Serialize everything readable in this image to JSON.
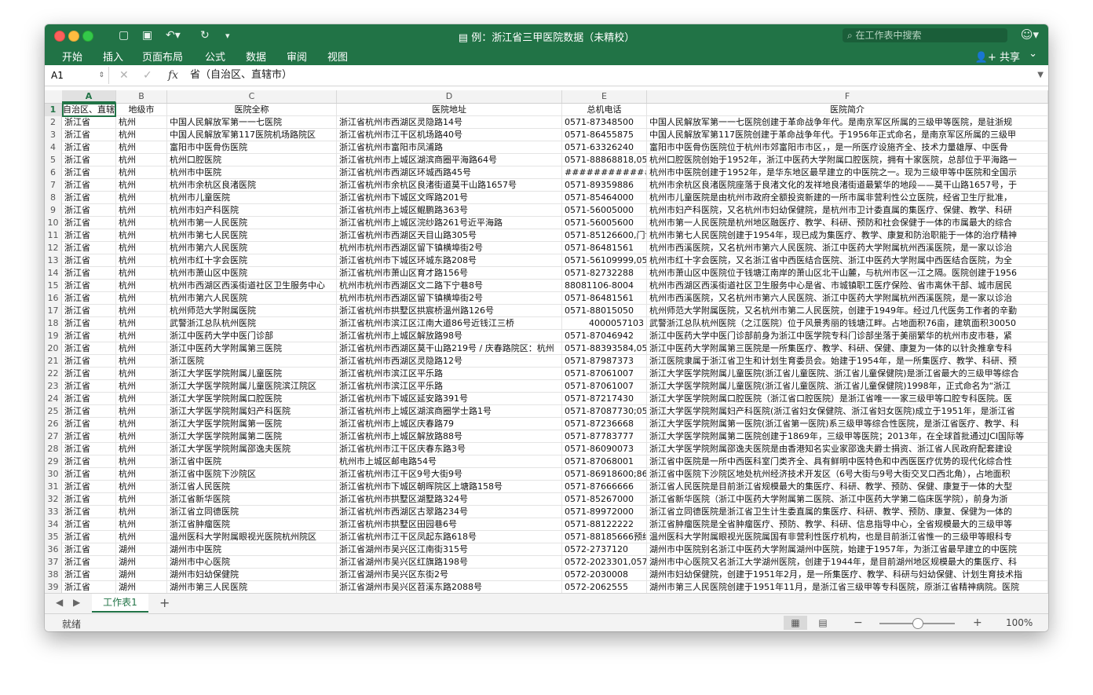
{
  "window": {
    "title": "例：浙江省三甲医院数据（未精校）",
    "search_placeholder": "在工作表中搜索"
  },
  "ribbon": {
    "tabs": [
      "开始",
      "插入",
      "页面布局",
      "公式",
      "数据",
      "审阅",
      "视图"
    ],
    "share_label": "共享"
  },
  "formula_bar": {
    "name_box": "A1",
    "fx": "fx",
    "formula": "省（自治区、直辖市）"
  },
  "grid": {
    "columns": [
      "A",
      "B",
      "C",
      "D",
      "E",
      "F"
    ],
    "header": [
      "自治区、直辖",
      "地级市",
      "医院全称",
      "医院地址",
      "总机电话",
      "医院简介"
    ],
    "rows": [
      [
        "浙江省",
        "杭州",
        "中国人民解放军第一一七医院",
        "浙江省杭州市西湖区灵隐路14号",
        "0571-87348500",
        "中国人民解放军第一一七医院创建于革命战争年代。是南京军区所属的三级甲等医院，是驻浙规"
      ],
      [
        "浙江省",
        "杭州",
        "中国人民解放军第117医院机场路院区",
        "浙江省杭州市江干区机场路40号",
        "0571-86455875",
        "中国人民解放军第117医院创建于革命战争年代。于1956年正式命名，是南京军区所属的三级甲"
      ],
      [
        "浙江省",
        "杭州",
        "富阳市中医骨伤医院",
        "浙江省杭州市富阳市凤浦路",
        "0571-63326240",
        "富阳市中医骨伤医院位于杭州市郊富阳市市区，，是一所医疗设施齐全、技术力量雄厚、中医骨"
      ],
      [
        "浙江省",
        "杭州",
        "杭州口腔医院",
        "浙江省杭州市上城区湖滨商圈平海路64号",
        "0571-88868818,057",
        "杭州口腔医院创始于1952年，浙江中医药大学附属口腔医院，拥有十家医院，总部位于平海路一"
      ],
      [
        "浙江省",
        "杭州",
        "杭州市中医院",
        "浙江省杭州市西湖区环城西路45号",
        "##############",
        "杭州市中医院创建于1952年，是华东地区最早建立的中医院之一。现为三级甲等中医院和全国示"
      ],
      [
        "浙江省",
        "杭州",
        "杭州市余杭区良渚医院",
        "浙江省杭州市余杭区良渚街道莫干山路1657号",
        "0571-89359886",
        "杭州市余杭区良渚医院座落于良渚文化的发祥地良渚街道最繁华的地段——莫干山路1657号，于"
      ],
      [
        "浙江省",
        "杭州",
        "杭州市儿童医院",
        "浙江省杭州市下城区文晖路201号",
        "0571-85464000",
        "杭州市儿童医院是由杭州市政府全额投资新建的一所市属非营利性公立医院，经省卫生厅批准，"
      ],
      [
        "浙江省",
        "杭州",
        "杭州市妇产科医院",
        "浙江省杭州市上城区鲲鹏路363号",
        "0571-56005000",
        "杭州市妇产科医院，又名杭州市妇幼保健院，是杭州市卫计委直属的集医疗、保健、教学、科研"
      ],
      [
        "浙江省",
        "杭州",
        "杭州市第一人民医院",
        "浙江省杭州市上城区浣纱路261号近平海路",
        "0571-56005600",
        "杭州市第一人民医院是杭州地区融医疗、教学、科研、预防和社会保健于一体的市属最大的综合"
      ],
      [
        "浙江省",
        "杭州",
        "杭州市第七人民医院",
        "浙江省杭州市西湖区天目山路305号",
        "0571-85126600,门诊",
        "杭州市第七人民医院创建于1954年，现已成为集医疗、教学、康复和防治职能于一体的治疗精神"
      ],
      [
        "浙江省",
        "杭州",
        "杭州市第六人民医院",
        "杭州市杭州市西湖区留下镇横埠街2号",
        "0571-86481561",
        "杭州市西溪医院，又名杭州市第六人民医院、浙江中医药大学附属杭州西溪医院，是一家以诊治"
      ],
      [
        "浙江省",
        "杭州",
        "杭州市红十字会医院",
        "浙江省杭州市下城区环城东路208号",
        "0571-56109999,057",
        "杭州市红十字会医院，又名浙江省中西医结合医院、浙江中医药大学附属中西医结合医院，为全"
      ],
      [
        "浙江省",
        "杭州",
        "杭州市萧山区中医院",
        "浙江省杭州市萧山区育才路156号",
        "0571-82732288",
        "杭州市萧山区中医院位于钱塘江南岸的萧山区北干山麓，与杭州市区一江之隔。医院创建于1956"
      ],
      [
        "浙江省",
        "杭州",
        "杭州市西湖区西溪街道社区卫生服务中心",
        "杭州市杭州市西湖区文二路下宁巷8号",
        "88081106-8004",
        "杭州市西湖区西溪街道社区卫生服务中心是省、市城镇职工医疗保险、省市离休干部、城市居民"
      ],
      [
        "浙江省",
        "杭州",
        "杭州市第六人民医院",
        "杭州市杭州市西湖区留下镇横埠街2号",
        "0571-86481561",
        "杭州市西溪医院，又名杭州市第六人民医院、浙江中医药大学附属杭州西溪医院，是一家以诊治"
      ],
      [
        "浙江省",
        "杭州",
        "杭州师范大学附属医院",
        "浙江省杭州市拱墅区拱宸桥温州路126号",
        "0571-88015050",
        "杭州师范大学附属医院，又名杭州市第二人民医院，创建于1949年。经过几代医务工作者的辛勤"
      ],
      [
        "浙江省",
        "杭州",
        "武警浙江总队杭州医院",
        "浙江省杭州市滨江区江南大道86号近钱江三桥",
        "4000057103",
        "武警浙江总队杭州医院（之江医院）位于风景秀丽的钱塘江畔。占地面积76亩，建筑面积30050"
      ],
      [
        "浙江省",
        "杭州",
        "浙江中医药大学中医门诊部",
        "浙江省杭州市上城区解放路98号",
        "0571-87046942",
        "浙江中医药大学中医门诊部前身为浙江中医学院专科门诊部坐落于美丽繁华的杭州市皮市巷，紧"
      ],
      [
        "浙江省",
        "杭州",
        "浙江中医药大学附属第三医院",
        "浙江省杭州市西湖区莫干山路219号 / 庆春路院区：杭州",
        "0571-88393584,057",
        "浙江中医药大学附属第三医院是一所集医疗、教学、科研、保健、康复为一体的以针灸推拿专科"
      ],
      [
        "浙江省",
        "杭州",
        "浙江医院",
        "浙江省杭州市西湖区灵隐路12号",
        "0571-87987373",
        "浙江医院隶属于浙江省卫生和计划生育委员会。始建于1954年，是一所集医疗、教学、科研、预"
      ],
      [
        "浙江省",
        "杭州",
        "浙江大学医学院附属儿童医院",
        "浙江省杭州市滨江区平乐路",
        "0571-87061007",
        "浙江大学医学院附属儿童医院(浙江省儿童医院、浙江省儿童保健院)是浙江省最大的三级甲等综合"
      ],
      [
        "浙江省",
        "杭州",
        "浙江大学医学院附属儿童医院滨江院区",
        "浙江省杭州市滨江区平乐路",
        "0571-87061007",
        "浙江大学医学院附属儿童医院(浙江省儿童医院、浙江省儿童保健院)1998年，正式命名为“浙江"
      ],
      [
        "浙江省",
        "杭州",
        "浙江大学医学院附属口腔医院",
        "浙江省杭州市下城区延安路391号",
        "0571-87217430",
        "浙江大学医学院附属口腔医院（浙江省口腔医院）是浙江省唯一一家三级甲等口腔专科医院。医"
      ],
      [
        "浙江省",
        "杭州",
        "浙江大学医学院附属妇产科医院",
        "浙江省杭州市上城区湖滨商圈学士路1号",
        "0571-87087730;057",
        "浙江大学医学院附属妇产科医院(浙江省妇女保健院、浙江省妇女医院)成立于1951年，是浙江省"
      ],
      [
        "浙江省",
        "杭州",
        "浙江大学医学院附属第一医院",
        "浙江省杭州市上城区庆春路79",
        "0571-87236668",
        "浙江大学医学院附属第一医院(浙江省第一医院)系三级甲等综合性医院，是浙江省医疗、教学、科"
      ],
      [
        "浙江省",
        "杭州",
        "浙江大学医学院附属第二医院",
        "浙江省杭州市上城区解放路88号",
        "0571-87783777",
        "浙江大学医学院附属第二医院创建于1869年，三级甲等医院；2013年，在全球首批通过JCI国际等"
      ],
      [
        "浙江省",
        "杭州",
        "浙江大学医学院附属邵逸夫医院",
        "浙江省杭州市江干区庆春东路3号",
        "0571-86090073",
        "浙江大学医学院附属邵逸夫医院是由香港知名实业家邵逸夫爵士捐资、浙江省人民政府配套建设"
      ],
      [
        "浙江省",
        "杭州",
        "浙江省中医院",
        "杭州市上城区邮电路54号",
        "0571-87068001",
        "浙江省中医院是一所中西医科室门类齐全、具有鲜明中医特色和中西医医疗优势的现代化综合性"
      ],
      [
        "浙江省",
        "杭州",
        "浙江省中医院下沙院区",
        "浙江省杭州市江干区9号大街9号",
        "0571-86918600;869",
        "浙江省中医院下沙院区地处杭州经济技术开发区（6号大街与9号大街交叉口西北角），占地面积"
      ],
      [
        "浙江省",
        "杭州",
        "浙江省人民医院",
        "浙江省杭州市下城区朝晖院区上塘路158号",
        "0571-87666666",
        "浙江省人民医院是目前浙江省规模最大的集医疗、科研、教学、预防、保健、康复于一体的大型"
      ],
      [
        "浙江省",
        "杭州",
        "浙江省新华医院",
        "浙江省杭州市拱墅区湖墅路324号",
        "0571-85267000",
        "浙江省新华医院（浙江中医药大学附属第二医院、浙江中医药大学第二临床医学院），前身为浙"
      ],
      [
        "浙江省",
        "杭州",
        "浙江省立同德医院",
        "浙江省杭州市西湖区古翠路234号",
        "0571-89972000",
        "浙江省立同德医院是浙江省卫生计生委直属的集医疗、科研、教学、预防、康复、保健为一体的"
      ],
      [
        "浙江省",
        "杭州",
        "浙江省肿瘤医院",
        "浙江省杭州市拱墅区田园巷6号",
        "0571-88122222",
        "浙江省肿瘤医院是全省肿瘤医疗、预防、教学、科研、信息指导中心，全省规模最大的三级甲等"
      ],
      [
        "浙江省",
        "杭州",
        "温州医科大学附属眼视光医院杭州院区",
        "浙江省杭州市江干区凤起东路618号",
        "0571-88185666预约",
        "温州医科大学附属眼视光医院属国有非营利性医疗机构，也是目前浙江省惟一的三级甲等眼科专"
      ],
      [
        "浙江省",
        "湖州",
        "湖州市中医院",
        "浙江省湖州市吴兴区江南街315号",
        "0572-2737120",
        "湖州市中医院别名浙江中医药大学附属湖州中医院，始建于1957年，为浙江省最早建立的中医院"
      ],
      [
        "浙江省",
        "湖州",
        "湖州市中心医院",
        "浙江省湖州市吴兴区红旗路198号",
        "0572-2023301,0572",
        "湖州市中心医院又名浙江大学湖州医院，创建于1944年，是目前湖州地区规模最大的集医疗、科"
      ],
      [
        "浙江省",
        "湖州",
        "湖州市妇幼保健院",
        "浙江省湖州市吴兴区东街2号",
        "0572-2030008",
        "湖州市妇幼保健院，创建于1951年2月，是一所集医疗、教学、科研与妇幼保健、计划生育技术指"
      ],
      [
        "浙江省",
        "湖州",
        "湖州市第三人民医院",
        "浙江省湖州市吴兴区苕溪东路2088号",
        "0572-2062555",
        "湖州市第三人民医院创建于1951年11月，是浙江省三级甲等专科医院，原浙江省精神病院。医院"
      ]
    ]
  },
  "sheets": {
    "tabs": [
      "工作表1"
    ],
    "add_icon": "plus-icon"
  },
  "status": {
    "text": "就绪",
    "zoom": "100%",
    "zoom_level": 0.5
  },
  "colors": {
    "accent": "#217346"
  }
}
